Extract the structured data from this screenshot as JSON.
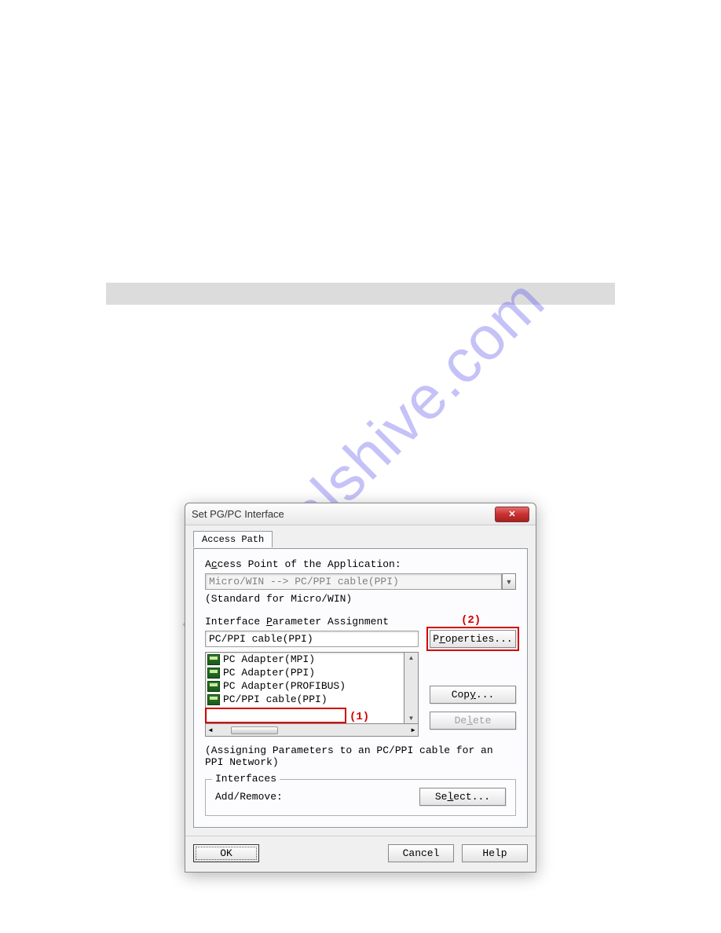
{
  "watermark": "manualshive.com",
  "dialog": {
    "title": "Set PG/PC Interface",
    "tab": "Access Path",
    "access_point_label_pre": "A",
    "access_point_label_u": "c",
    "access_point_label_post": "cess Point of the Application:",
    "access_point_value": "Micro/WIN      --> PC/PPI cable(PPI)",
    "standard_note": "(Standard for Micro/WIN)",
    "interface_label_pre": "Interface ",
    "interface_label_u": "P",
    "interface_label_post": "arameter Assignment",
    "interface_value": "PC/PPI cable(PPI)",
    "list_items": [
      "PC Adapter(MPI)",
      "PC Adapter(PPI)",
      "PC Adapter(PROFIBUS)",
      "PC/PPI cable(PPI)"
    ],
    "annotations": {
      "one": "(1)",
      "two": "(2)"
    },
    "buttons": {
      "properties_pre": "P",
      "properties_u": "r",
      "properties_post": "operties...",
      "copy_pre": "Cop",
      "copy_u": "y",
      "copy_post": "...",
      "delete_pre": "De",
      "delete_u": "l",
      "delete_post": "ete",
      "select_pre": "Se",
      "select_u": "l",
      "select_post": "ect...",
      "ok": "OK",
      "cancel": "Cancel",
      "help": "Help"
    },
    "assign_desc": "(Assigning Parameters to an PC/PPI cable for an PPI Network)",
    "interfaces_legend": "Interfaces",
    "add_remove": "Add/Remove:"
  }
}
